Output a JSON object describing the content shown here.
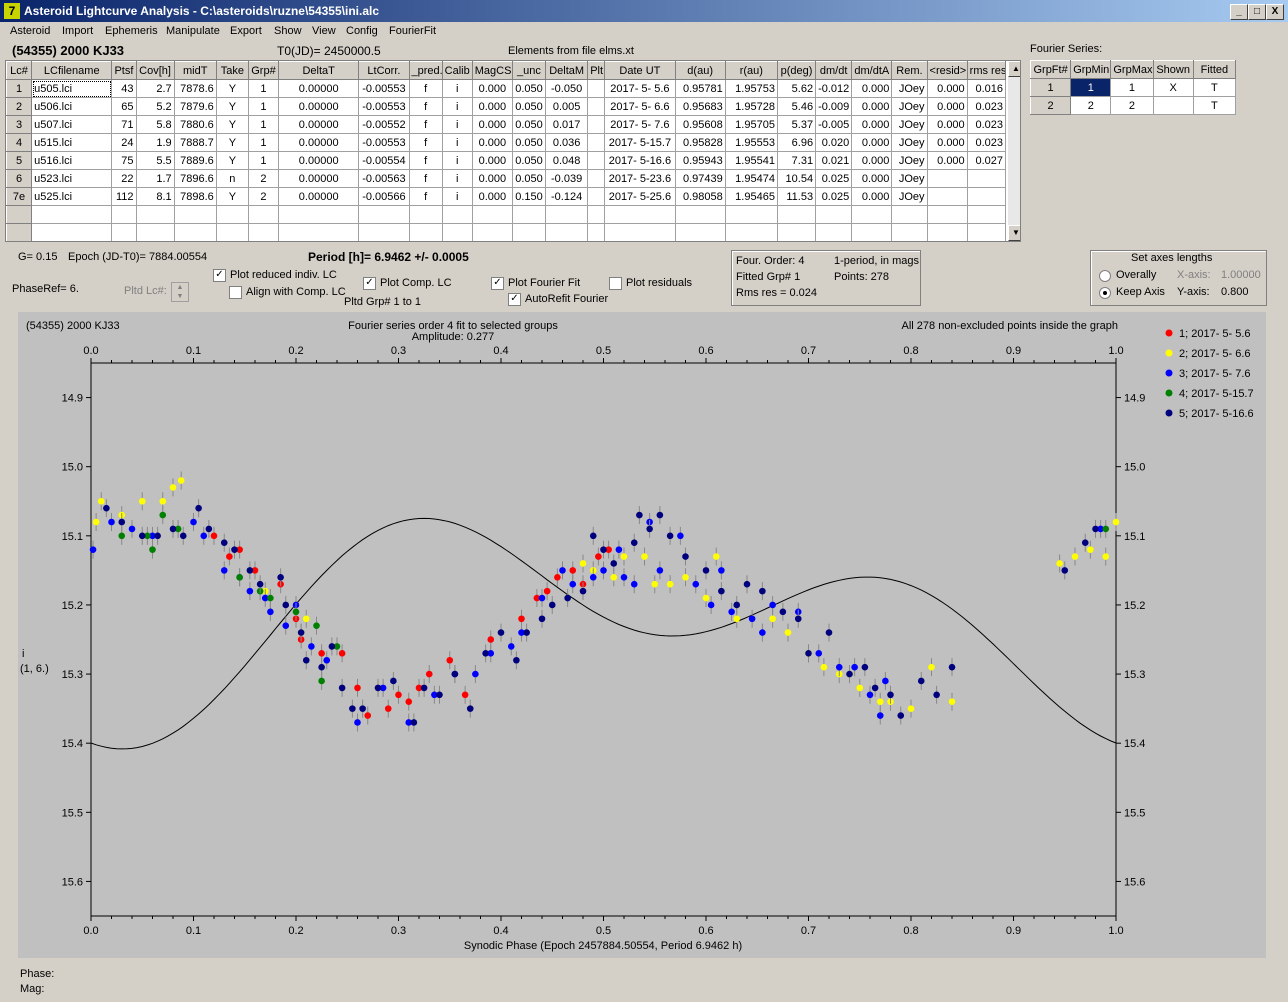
{
  "window": {
    "title": "Asteroid Lightcurve Analysis - C:\\asteroids\\ruzne\\54355\\ini.alc",
    "controls": [
      "_",
      "□",
      "X"
    ]
  },
  "menu": [
    "Asteroid",
    "Import",
    "Ephemeris",
    "Manipulate",
    "Export",
    "Show",
    "View",
    "Config",
    "FourierFit"
  ],
  "header": {
    "asteroid": "(54355) 2000 KJ33",
    "t0": "T0(JD)= 2450000.5",
    "elements": "Elements from file elms.xt"
  },
  "lc_table": {
    "columns": [
      "Lc#",
      "LCfilename",
      "Ptsf",
      "Cov[h]",
      "midT",
      "Take",
      "Grp#",
      "DeltaT",
      "LtCorr.",
      "_pred.",
      "Calib",
      "MagCS",
      "_unc",
      "DeltaM",
      "Plt",
      "Date UT",
      "d(au)",
      "r(au)",
      "p(deg)",
      "dm/dt",
      "dm/dtA",
      "Rem.",
      "<resid>",
      "rms res"
    ],
    "rows": [
      [
        "1",
        "u505.lci",
        "43",
        "2.7",
        "7878.6",
        "Y",
        "1",
        "0.00000",
        "-0.00553",
        "f",
        "i",
        "0.000",
        "0.050",
        "-0.050",
        "",
        "2017- 5- 5.6",
        "0.95781",
        "1.95753",
        "5.62",
        "-0.012",
        "0.000",
        "JOey",
        "0.000",
        "0.016"
      ],
      [
        "2",
        "u506.lci",
        "65",
        "5.2",
        "7879.6",
        "Y",
        "1",
        "0.00000",
        "-0.00553",
        "f",
        "i",
        "0.000",
        "0.050",
        "0.005",
        "",
        "2017- 5- 6.6",
        "0.95683",
        "1.95728",
        "5.46",
        "-0.009",
        "0.000",
        "JOey",
        "0.000",
        "0.023"
      ],
      [
        "3",
        "u507.lci",
        "71",
        "5.8",
        "7880.6",
        "Y",
        "1",
        "0.00000",
        "-0.00552",
        "f",
        "i",
        "0.000",
        "0.050",
        "0.017",
        "",
        "2017- 5- 7.6",
        "0.95608",
        "1.95705",
        "5.37",
        "-0.005",
        "0.000",
        "JOey",
        "0.000",
        "0.023"
      ],
      [
        "4",
        "u515.lci",
        "24",
        "1.9",
        "7888.7",
        "Y",
        "1",
        "0.00000",
        "-0.00553",
        "f",
        "i",
        "0.000",
        "0.050",
        "0.036",
        "",
        "2017- 5-15.7",
        "0.95828",
        "1.95553",
        "6.96",
        "0.020",
        "0.000",
        "JOey",
        "0.000",
        "0.023"
      ],
      [
        "5",
        "u516.lci",
        "75",
        "5.5",
        "7889.6",
        "Y",
        "1",
        "0.00000",
        "-0.00554",
        "f",
        "i",
        "0.000",
        "0.050",
        "0.048",
        "",
        "2017- 5-16.6",
        "0.95943",
        "1.95541",
        "7.31",
        "0.021",
        "0.000",
        "JOey",
        "0.000",
        "0.027"
      ],
      [
        "6",
        "u523.lci",
        "22",
        "1.7",
        "7896.6",
        "n",
        "2",
        "0.00000",
        "-0.00563",
        "f",
        "i",
        "0.000",
        "0.050",
        "-0.039",
        "",
        "2017- 5-23.6",
        "0.97439",
        "1.95474",
        "10.54",
        "0.025",
        "0.000",
        "JOey",
        "",
        ""
      ],
      [
        "7e",
        "u525.lci",
        "112",
        "8.1",
        "7898.6",
        "Y",
        "2",
        "0.00000",
        "-0.00566",
        "f",
        "i",
        "0.000",
        "0.150",
        "-0.124",
        "",
        "2017- 5-25.6",
        "0.98058",
        "1.95465",
        "11.53",
        "0.025",
        "0.000",
        "JOey",
        "",
        ""
      ]
    ]
  },
  "fourier_series": {
    "title": "Fourier Series:",
    "columns": [
      "GrpFt#",
      "GrpMin",
      "GrpMax",
      "Shown",
      "Fitted"
    ],
    "rows": [
      [
        "1",
        "1",
        "1",
        "X",
        "T"
      ],
      [
        "2",
        "2",
        "2",
        "",
        "T"
      ]
    ]
  },
  "controls": {
    "g": "G= 0.15",
    "epoch": "Epoch (JD-T0)= 7884.00554",
    "period": "Period [h]= 6.9462 +/- 0.0005",
    "phaseref": "PhaseRef= 6.",
    "pltd_lc": "Pltd Lc#:",
    "plot_reduced": "Plot reduced indiv. LC",
    "align_comp": "Align with Comp. LC",
    "plot_comp": "Plot Comp. LC",
    "pltd_grp": "Pltd Grp#  1   to   1",
    "plot_fourier": "Plot Fourier Fit",
    "autorefit": "AutoRefit Fourier",
    "plot_residuals": "Plot residuals",
    "four_order": "Four. Order:  4",
    "period_mode": "1-period, in mags",
    "fitted_grp": "Fitted Grp# 1",
    "points": "Points: 278",
    "rms": "Rms res      = 0.024",
    "axes_title": "Set axes lengths",
    "overally": "Overally",
    "keep_axis": "Keep Axis",
    "x_axis_label": "X-axis:",
    "x_axis_val": "1.00000",
    "y_axis_label": "Y-axis:",
    "y_axis_val": "0.800"
  },
  "status": {
    "phase": "Phase:",
    "mag": "Mag:"
  },
  "chart_data": {
    "type": "scatter",
    "title": "Fourier series order 4 fit to selected groups",
    "subtitle": "Amplitude: 0.277",
    "left_note": "(54355) 2000 KJ33",
    "right_note": "All 278 non-excluded points inside the graph",
    "xlabel": "Synodic Phase (Epoch 2457884.50554, Period 6.9462 h)",
    "ylabel": "i",
    "ylabel2": "(1, 6.)",
    "xlim": [
      0,
      1
    ],
    "ylim": [
      15.65,
      14.85
    ],
    "xticks": [
      "0.0",
      "0.1",
      "0.2",
      "0.3",
      "0.4",
      "0.5",
      "0.6",
      "0.7",
      "0.8",
      "0.9",
      "1.0"
    ],
    "yticks": [
      "14.9",
      "15.0",
      "15.1",
      "15.2",
      "15.3",
      "15.4",
      "15.5",
      "15.6"
    ],
    "series": [
      {
        "name": "1; 2017- 5- 5.6",
        "color": "#ff0000",
        "points": [
          [
            0.12,
            15.1
          ],
          [
            0.135,
            15.13
          ],
          [
            0.145,
            15.12
          ],
          [
            0.16,
            15.15
          ],
          [
            0.185,
            15.17
          ],
          [
            0.2,
            15.22
          ],
          [
            0.205,
            15.25
          ],
          [
            0.225,
            15.27
          ],
          [
            0.245,
            15.27
          ],
          [
            0.26,
            15.32
          ],
          [
            0.27,
            15.36
          ],
          [
            0.29,
            15.35
          ],
          [
            0.3,
            15.33
          ],
          [
            0.31,
            15.34
          ],
          [
            0.32,
            15.32
          ],
          [
            0.33,
            15.3
          ],
          [
            0.35,
            15.28
          ],
          [
            0.365,
            15.33
          ],
          [
            0.39,
            15.25
          ],
          [
            0.42,
            15.22
          ],
          [
            0.435,
            15.19
          ],
          [
            0.445,
            15.18
          ],
          [
            0.455,
            15.16
          ],
          [
            0.47,
            15.15
          ],
          [
            0.48,
            15.17
          ],
          [
            0.495,
            15.13
          ],
          [
            0.505,
            15.12
          ]
        ]
      },
      {
        "name": "2; 2017- 5- 6.6",
        "color": "#ffff00",
        "points": [
          [
            0.005,
            15.08
          ],
          [
            0.01,
            15.05
          ],
          [
            0.03,
            15.07
          ],
          [
            0.05,
            15.05
          ],
          [
            0.07,
            15.05
          ],
          [
            0.08,
            15.03
          ],
          [
            0.088,
            15.02
          ],
          [
            0.17,
            15.18
          ],
          [
            0.2,
            15.2
          ],
          [
            0.205,
            15.24
          ],
          [
            0.21,
            15.22
          ],
          [
            0.48,
            15.14
          ],
          [
            0.49,
            15.15
          ],
          [
            0.51,
            15.16
          ],
          [
            0.52,
            15.13
          ],
          [
            0.54,
            15.13
          ],
          [
            0.55,
            15.17
          ],
          [
            0.565,
            15.17
          ],
          [
            0.58,
            15.16
          ],
          [
            0.6,
            15.19
          ],
          [
            0.61,
            15.13
          ],
          [
            0.63,
            15.22
          ],
          [
            0.665,
            15.22
          ],
          [
            0.68,
            15.24
          ],
          [
            0.7,
            15.27
          ],
          [
            0.715,
            15.29
          ],
          [
            0.73,
            15.3
          ],
          [
            0.74,
            15.3
          ],
          [
            0.75,
            15.32
          ],
          [
            0.77,
            15.34
          ],
          [
            0.78,
            15.34
          ],
          [
            0.8,
            15.35
          ],
          [
            0.82,
            15.29
          ],
          [
            0.84,
            15.34
          ],
          [
            0.945,
            15.14
          ],
          [
            0.96,
            15.13
          ],
          [
            0.975,
            15.12
          ],
          [
            0.99,
            15.13
          ],
          [
            1.0,
            15.08
          ]
        ]
      },
      {
        "name": "3; 2017- 5- 7.6",
        "color": "#0000ff",
        "points": [
          [
            0.002,
            15.12
          ],
          [
            0.02,
            15.08
          ],
          [
            0.04,
            15.09
          ],
          [
            0.06,
            15.1
          ],
          [
            0.1,
            15.08
          ],
          [
            0.11,
            15.1
          ],
          [
            0.13,
            15.15
          ],
          [
            0.145,
            15.16
          ],
          [
            0.155,
            15.18
          ],
          [
            0.17,
            15.19
          ],
          [
            0.175,
            15.21
          ],
          [
            0.19,
            15.23
          ],
          [
            0.2,
            15.2
          ],
          [
            0.215,
            15.26
          ],
          [
            0.23,
            15.28
          ],
          [
            0.26,
            15.37
          ],
          [
            0.285,
            15.32
          ],
          [
            0.31,
            15.37
          ],
          [
            0.335,
            15.33
          ],
          [
            0.355,
            15.3
          ],
          [
            0.375,
            15.3
          ],
          [
            0.39,
            15.27
          ],
          [
            0.41,
            15.26
          ],
          [
            0.42,
            15.24
          ],
          [
            0.44,
            15.19
          ],
          [
            0.46,
            15.15
          ],
          [
            0.47,
            15.17
          ],
          [
            0.49,
            15.16
          ],
          [
            0.5,
            15.15
          ],
          [
            0.515,
            15.12
          ],
          [
            0.52,
            15.16
          ],
          [
            0.53,
            15.17
          ],
          [
            0.545,
            15.08
          ],
          [
            0.555,
            15.15
          ],
          [
            0.575,
            15.1
          ],
          [
            0.59,
            15.17
          ],
          [
            0.605,
            15.2
          ],
          [
            0.615,
            15.15
          ],
          [
            0.625,
            15.21
          ],
          [
            0.645,
            15.22
          ],
          [
            0.655,
            15.24
          ],
          [
            0.665,
            15.2
          ],
          [
            0.69,
            15.21
          ],
          [
            0.71,
            15.27
          ],
          [
            0.73,
            15.29
          ],
          [
            0.745,
            15.29
          ],
          [
            0.76,
            15.33
          ],
          [
            0.77,
            15.36
          ],
          [
            0.775,
            15.31
          ],
          [
            0.985,
            15.09
          ]
        ]
      },
      {
        "name": "4; 2017- 5-15.7",
        "color": "#008000",
        "points": [
          [
            0.03,
            15.1
          ],
          [
            0.055,
            15.1
          ],
          [
            0.06,
            15.12
          ],
          [
            0.07,
            15.07
          ],
          [
            0.085,
            15.09
          ],
          [
            0.145,
            15.16
          ],
          [
            0.165,
            15.18
          ],
          [
            0.175,
            15.19
          ],
          [
            0.2,
            15.21
          ],
          [
            0.22,
            15.23
          ],
          [
            0.225,
            15.31
          ],
          [
            0.24,
            15.26
          ],
          [
            0.99,
            15.09
          ]
        ]
      },
      {
        "name": "5; 2017- 5-16.6",
        "color": "#00007f",
        "points": [
          [
            0.015,
            15.06
          ],
          [
            0.03,
            15.08
          ],
          [
            0.05,
            15.1
          ],
          [
            0.065,
            15.1
          ],
          [
            0.08,
            15.09
          ],
          [
            0.09,
            15.1
          ],
          [
            0.105,
            15.06
          ],
          [
            0.115,
            15.09
          ],
          [
            0.13,
            15.11
          ],
          [
            0.14,
            15.12
          ],
          [
            0.155,
            15.15
          ],
          [
            0.165,
            15.17
          ],
          [
            0.185,
            15.16
          ],
          [
            0.19,
            15.2
          ],
          [
            0.205,
            15.24
          ],
          [
            0.21,
            15.28
          ],
          [
            0.225,
            15.29
          ],
          [
            0.235,
            15.26
          ],
          [
            0.245,
            15.32
          ],
          [
            0.255,
            15.35
          ],
          [
            0.265,
            15.35
          ],
          [
            0.28,
            15.32
          ],
          [
            0.295,
            15.31
          ],
          [
            0.315,
            15.37
          ],
          [
            0.325,
            15.32
          ],
          [
            0.34,
            15.33
          ],
          [
            0.355,
            15.3
          ],
          [
            0.37,
            15.35
          ],
          [
            0.385,
            15.27
          ],
          [
            0.4,
            15.24
          ],
          [
            0.415,
            15.28
          ],
          [
            0.425,
            15.24
          ],
          [
            0.44,
            15.22
          ],
          [
            0.45,
            15.2
          ],
          [
            0.465,
            15.19
          ],
          [
            0.48,
            15.18
          ],
          [
            0.49,
            15.1
          ],
          [
            0.5,
            15.12
          ],
          [
            0.51,
            15.14
          ],
          [
            0.53,
            15.11
          ],
          [
            0.535,
            15.07
          ],
          [
            0.545,
            15.09
          ],
          [
            0.555,
            15.07
          ],
          [
            0.565,
            15.1
          ],
          [
            0.58,
            15.13
          ],
          [
            0.6,
            15.15
          ],
          [
            0.615,
            15.18
          ],
          [
            0.63,
            15.2
          ],
          [
            0.64,
            15.17
          ],
          [
            0.655,
            15.18
          ],
          [
            0.675,
            15.21
          ],
          [
            0.69,
            15.22
          ],
          [
            0.7,
            15.27
          ],
          [
            0.72,
            15.24
          ],
          [
            0.74,
            15.3
          ],
          [
            0.755,
            15.29
          ],
          [
            0.765,
            15.32
          ],
          [
            0.78,
            15.33
          ],
          [
            0.79,
            15.36
          ],
          [
            0.81,
            15.31
          ],
          [
            0.825,
            15.33
          ],
          [
            0.84,
            15.29
          ],
          [
            0.95,
            15.15
          ],
          [
            0.97,
            15.11
          ],
          [
            0.98,
            15.09
          ]
        ]
      }
    ]
  }
}
